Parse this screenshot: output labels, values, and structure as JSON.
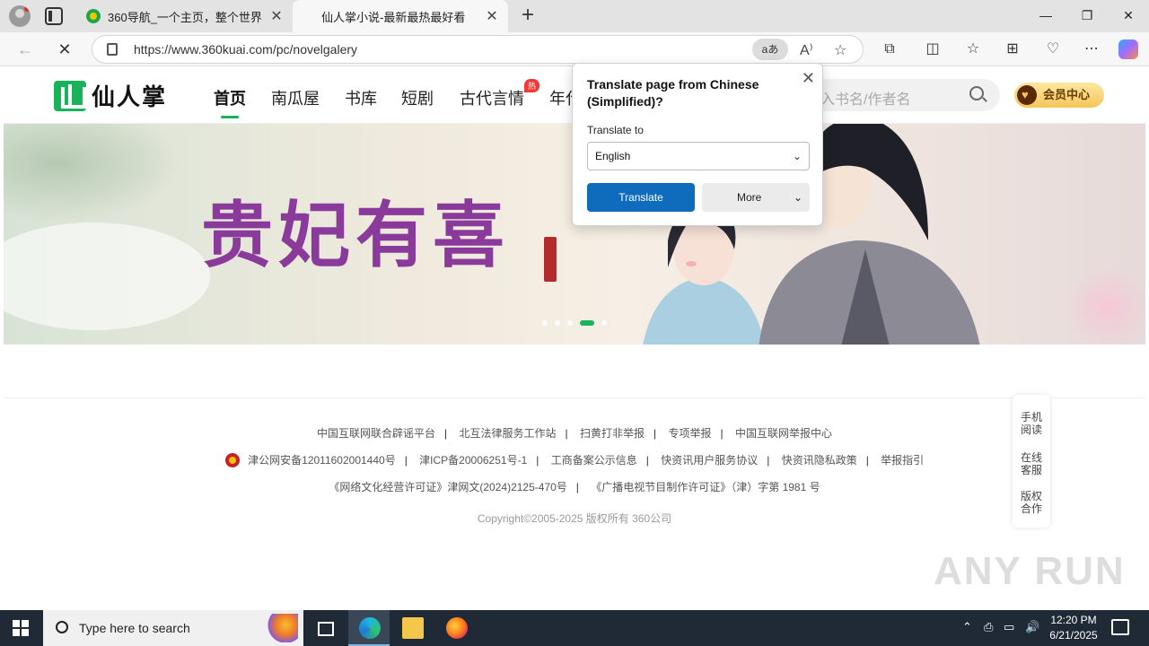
{
  "browser": {
    "tabs": [
      {
        "title": "360导航_一个主页，整个世界",
        "close": "✕"
      },
      {
        "title": "仙人掌小说-最新最热最好看",
        "close": "✕"
      }
    ],
    "new_tab": "+",
    "url": "https://www.360kuai.com/pc/novelgalery",
    "translate_badge": "aあ",
    "window_controls": [
      "—",
      "❐",
      "✕"
    ]
  },
  "site": {
    "logo_text": "仙人掌",
    "nav": [
      "首页",
      "南瓜屋",
      "书库",
      "短剧",
      "古代言情",
      "年代"
    ],
    "hot_badge": "热",
    "search_placeholder": "入书名/作者名",
    "vip_label": "会员中心"
  },
  "banner": {
    "title": "贵妃有喜",
    "slide_count": 5,
    "active_slide": 4
  },
  "footer": {
    "row1": [
      "中国互联网联合辟谣平台",
      "北互法律服务工作站",
      "扫黄打非举报",
      "专项举报",
      "中国互联网举报中心"
    ],
    "row2": [
      "津公网安备12011602001440号",
      "津ICP备20006251号-1",
      "工商备案公示信息",
      "快资讯用户服务协议",
      "快资讯隐私政策",
      "举报指引"
    ],
    "row3": [
      "《网络文化经营许可证》津网文(2024)2125-470号",
      "《广播电视节目制作许可证》（津）字第 1981 号"
    ],
    "copyright": "Copyright©2005-2025 版权所有 360公司"
  },
  "sidebar": [
    {
      "line1": "手机",
      "line2": "阅读"
    },
    {
      "line1": "在线",
      "line2": "客服"
    },
    {
      "line1": "版权",
      "line2": "合作"
    }
  ],
  "watermark": "ANY RUN",
  "translate_popup": {
    "title": "Translate page from Chinese (Simplified)?",
    "label": "Translate to",
    "selected_language": "English",
    "translate_button": "Translate",
    "more_button": "More",
    "close": "✕"
  },
  "taskbar": {
    "search_placeholder": "Type here to search",
    "time": "12:20 PM",
    "date": "6/21/2025"
  }
}
